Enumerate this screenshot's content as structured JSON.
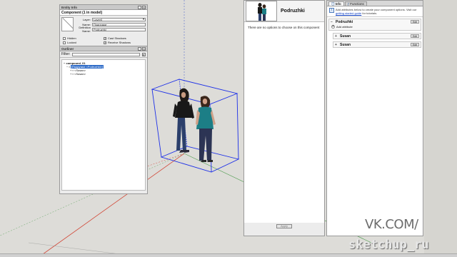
{
  "entity_info": {
    "title": "Entity Info",
    "header": "Component (1 in model)",
    "fields": [
      {
        "label": "Layer:",
        "value": "Layer0",
        "type": "select"
      },
      {
        "label": "Name:",
        "value": "Подружки",
        "type": "text"
      },
      {
        "label": "Definition Name:",
        "value": "Podruzhki",
        "type": "text"
      }
    ],
    "checks": [
      {
        "label": "Hidden",
        "checked": false
      },
      {
        "label": "Cast Shadows",
        "checked": true
      },
      {
        "label": "Locked",
        "checked": false
      },
      {
        "label": "Receive Shadows",
        "checked": true
      }
    ]
  },
  "outliner": {
    "title": "Outliner",
    "filter_label": "Filter:",
    "tree": [
      {
        "label": "compound_01",
        "depth": 0,
        "bold": true,
        "selected": false,
        "expander": "−"
      },
      {
        "label": "[Подружки <Podruzhki>]",
        "depth": 1,
        "bold": false,
        "selected": true,
        "expander": "−"
      },
      {
        "label": "<Susan>",
        "depth": 2,
        "bold": false,
        "selected": false,
        "expander": "+"
      },
      {
        "label": "<Susan>",
        "depth": 2,
        "bold": false,
        "selected": false,
        "expander": "+"
      }
    ]
  },
  "component_options": {
    "name": "Podruzhki",
    "message": "There are no options to choose on this component",
    "apply_label": "Apply"
  },
  "component_attributes": {
    "tabs": [
      {
        "label": "Info",
        "active": true
      },
      {
        "label": "Functions",
        "active": false
      }
    ],
    "info_text": "Add attributes below to create your component options. Visit our",
    "info_link": "getting started guide",
    "info_tail": "for tutorials.",
    "sections": [
      {
        "title": "Podruzhki",
        "toggle": "−",
        "button": "Edit",
        "add_label": "Add attribute"
      },
      {
        "title": "Susan",
        "toggle": "+",
        "button": "Edit",
        "add_label": ""
      },
      {
        "title": "Susan",
        "toggle": "+",
        "button": "Edit",
        "add_label": ""
      }
    ]
  },
  "watermark": {
    "vk": "VK.COM/",
    "brand": "sketchup_ru"
  },
  "colors": {
    "selection_box": "#1c2fe8",
    "axis_red": "#d24a3a",
    "axis_green": "#4a9a4a",
    "axis_blue": "#3a55c8",
    "link": "#0b3cc1"
  }
}
